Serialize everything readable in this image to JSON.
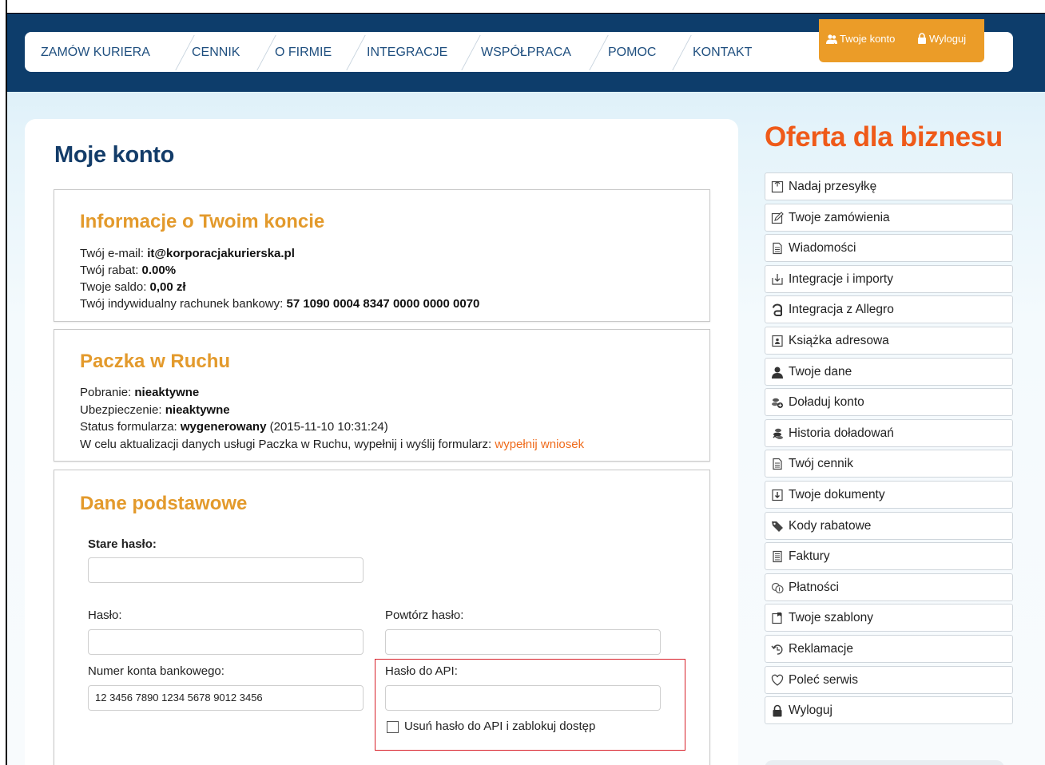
{
  "nav": {
    "items": [
      {
        "label": "ZAMÓW KURIERA"
      },
      {
        "label": "CENNIK"
      },
      {
        "label": "O FIRMIE"
      },
      {
        "label": "INTEGRACJE"
      },
      {
        "label": "WSPÓŁPRACA"
      },
      {
        "label": "POMOC"
      },
      {
        "label": "KONTAKT"
      }
    ],
    "account_label": "Twoje konto",
    "logout_label": "Wyloguj"
  },
  "page_title": "Moje konto",
  "account_info": {
    "title": "Informacje o Twoim koncie",
    "email_label": "Twój e-mail: ",
    "email_value": "it@korporacjakurierska.pl",
    "discount_label": "Twój rabat: ",
    "discount_value": "0.00%",
    "balance_label": "Twoje saldo: ",
    "balance_value": "0,00 zł",
    "bank_label": "Twój indywidualny rachunek bankowy: ",
    "bank_value": "57 1090 0004 8347 0000 0000 0070"
  },
  "ruch": {
    "title": "Paczka w Ruchu",
    "pobranie_label": "Pobranie: ",
    "pobranie_value": "nieaktywne",
    "insurance_label": "Ubezpieczenie: ",
    "insurance_value": "nieaktywne",
    "status_label": "Status formularza: ",
    "status_value": "wygenerowany",
    "status_date": " (2015-11-10 10:31:24)",
    "update_text": "W celu aktualizacji danych usługi Paczka w Ruchu, wypełnij i wyślij formularz: ",
    "update_link": "wypełnij wniosek"
  },
  "basic": {
    "title": "Dane podstawowe",
    "old_password_label": "Stare hasło:",
    "password_label": "Hasło:",
    "repeat_password_label": "Powtórz hasło:",
    "bank_account_label": "Numer konta bankowego:",
    "bank_account_value": "12 3456 7890 1234 5678 9012 3456",
    "api_password_label": "Hasło do API:",
    "remove_api_label": "Usuń hasło do API i zablokuj dostęp"
  },
  "sidebar": {
    "title": "Oferta dla biznesu",
    "items": [
      {
        "label": "Nadaj przesyłkę",
        "icon": "package-icon"
      },
      {
        "label": "Twoje zamówienia",
        "icon": "edit-icon"
      },
      {
        "label": "Wiadomości",
        "icon": "document-icon"
      },
      {
        "label": "Integracje i importy",
        "icon": "import-icon"
      },
      {
        "label": "Integracja z Allegro",
        "icon": "allegro-icon"
      },
      {
        "label": "Książka adresowa",
        "icon": "address-book-icon"
      },
      {
        "label": "Twoje dane",
        "icon": "user-icon"
      },
      {
        "label": "Doładuj konto",
        "icon": "coins-add-icon"
      },
      {
        "label": "Historia doładowań",
        "icon": "coins-history-icon"
      },
      {
        "label": "Twój cennik",
        "icon": "document-icon"
      },
      {
        "label": "Twoje dokumenty",
        "icon": "download-doc-icon"
      },
      {
        "label": "Kody rabatowe",
        "icon": "tag-icon"
      },
      {
        "label": "Faktury",
        "icon": "invoice-icon"
      },
      {
        "label": "Płatności",
        "icon": "payment-icon"
      },
      {
        "label": "Twoje szablony",
        "icon": "template-icon"
      },
      {
        "label": "Reklamacje",
        "icon": "undo-icon"
      },
      {
        "label": "Poleć serwis",
        "icon": "heart-icon"
      },
      {
        "label": "Wyloguj",
        "icon": "lock-icon"
      }
    ]
  },
  "colors": {
    "header_bg": "#0d3d6b",
    "nav_text": "#1f4f7f",
    "account_bg": "#eb9c28",
    "box_title": "#e39a2c",
    "sidebar_title": "#ef5a19",
    "link": "#ef6a1a",
    "highlight_border": "#d8202a"
  }
}
